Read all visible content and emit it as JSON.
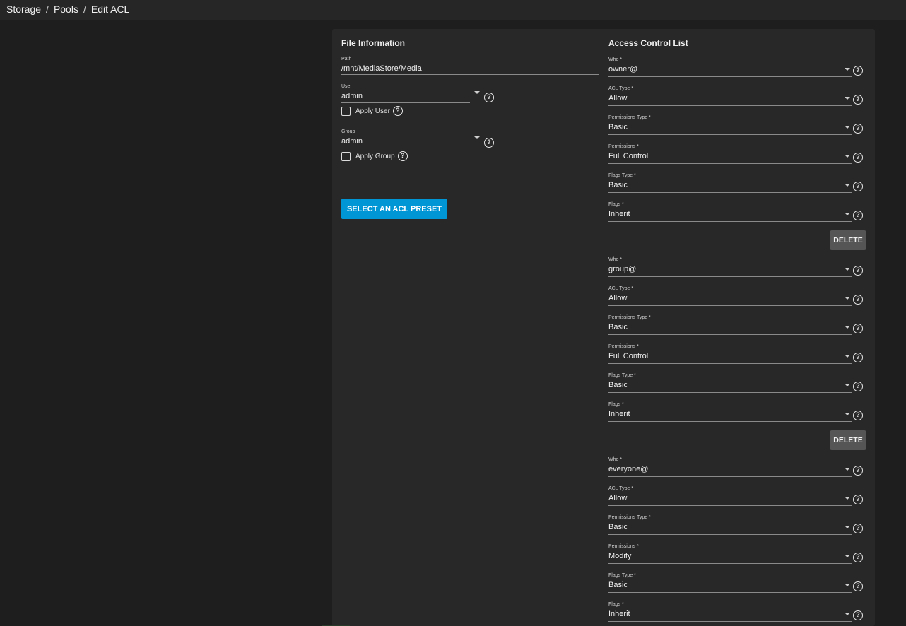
{
  "breadcrumb": [
    "Storage",
    "Pools",
    "Edit ACL"
  ],
  "file_info": {
    "title": "File Information",
    "path_label": "Path",
    "path_value": "/mnt/MediaStore/Media",
    "user_label": "User",
    "user_value": "admin",
    "apply_user_label": "Apply User",
    "group_label": "Group",
    "group_value": "admin",
    "apply_group_label": "Apply Group",
    "preset_button": "SELECT AN ACL PRESET"
  },
  "acl": {
    "title": "Access Control List",
    "delete_label": "DELETE",
    "entries": [
      {
        "fields": [
          {
            "label": "Who *",
            "value": "owner@"
          },
          {
            "label": "ACL Type *",
            "value": "Allow"
          },
          {
            "label": "Permissions Type *",
            "value": "Basic"
          },
          {
            "label": "Permissions *",
            "value": "Full Control"
          },
          {
            "label": "Flags Type *",
            "value": "Basic"
          },
          {
            "label": "Flags *",
            "value": "Inherit"
          }
        ]
      },
      {
        "fields": [
          {
            "label": "Who *",
            "value": "group@"
          },
          {
            "label": "ACL Type *",
            "value": "Allow"
          },
          {
            "label": "Permissions Type *",
            "value": "Basic"
          },
          {
            "label": "Permissions *",
            "value": "Full Control"
          },
          {
            "label": "Flags Type *",
            "value": "Basic"
          },
          {
            "label": "Flags *",
            "value": "Inherit"
          }
        ]
      },
      {
        "fields": [
          {
            "label": "Who *",
            "value": "everyone@"
          },
          {
            "label": "ACL Type *",
            "value": "Allow"
          },
          {
            "label": "Permissions Type *",
            "value": "Basic"
          },
          {
            "label": "Permissions *",
            "value": "Modify"
          },
          {
            "label": "Flags Type *",
            "value": "Basic"
          },
          {
            "label": "Flags *",
            "value": "Inherit"
          }
        ]
      }
    ]
  },
  "icons": {
    "help": "help-circle-icon",
    "dropdown": "chevron-down-icon",
    "checkbox": "checkbox-unchecked-icon"
  }
}
